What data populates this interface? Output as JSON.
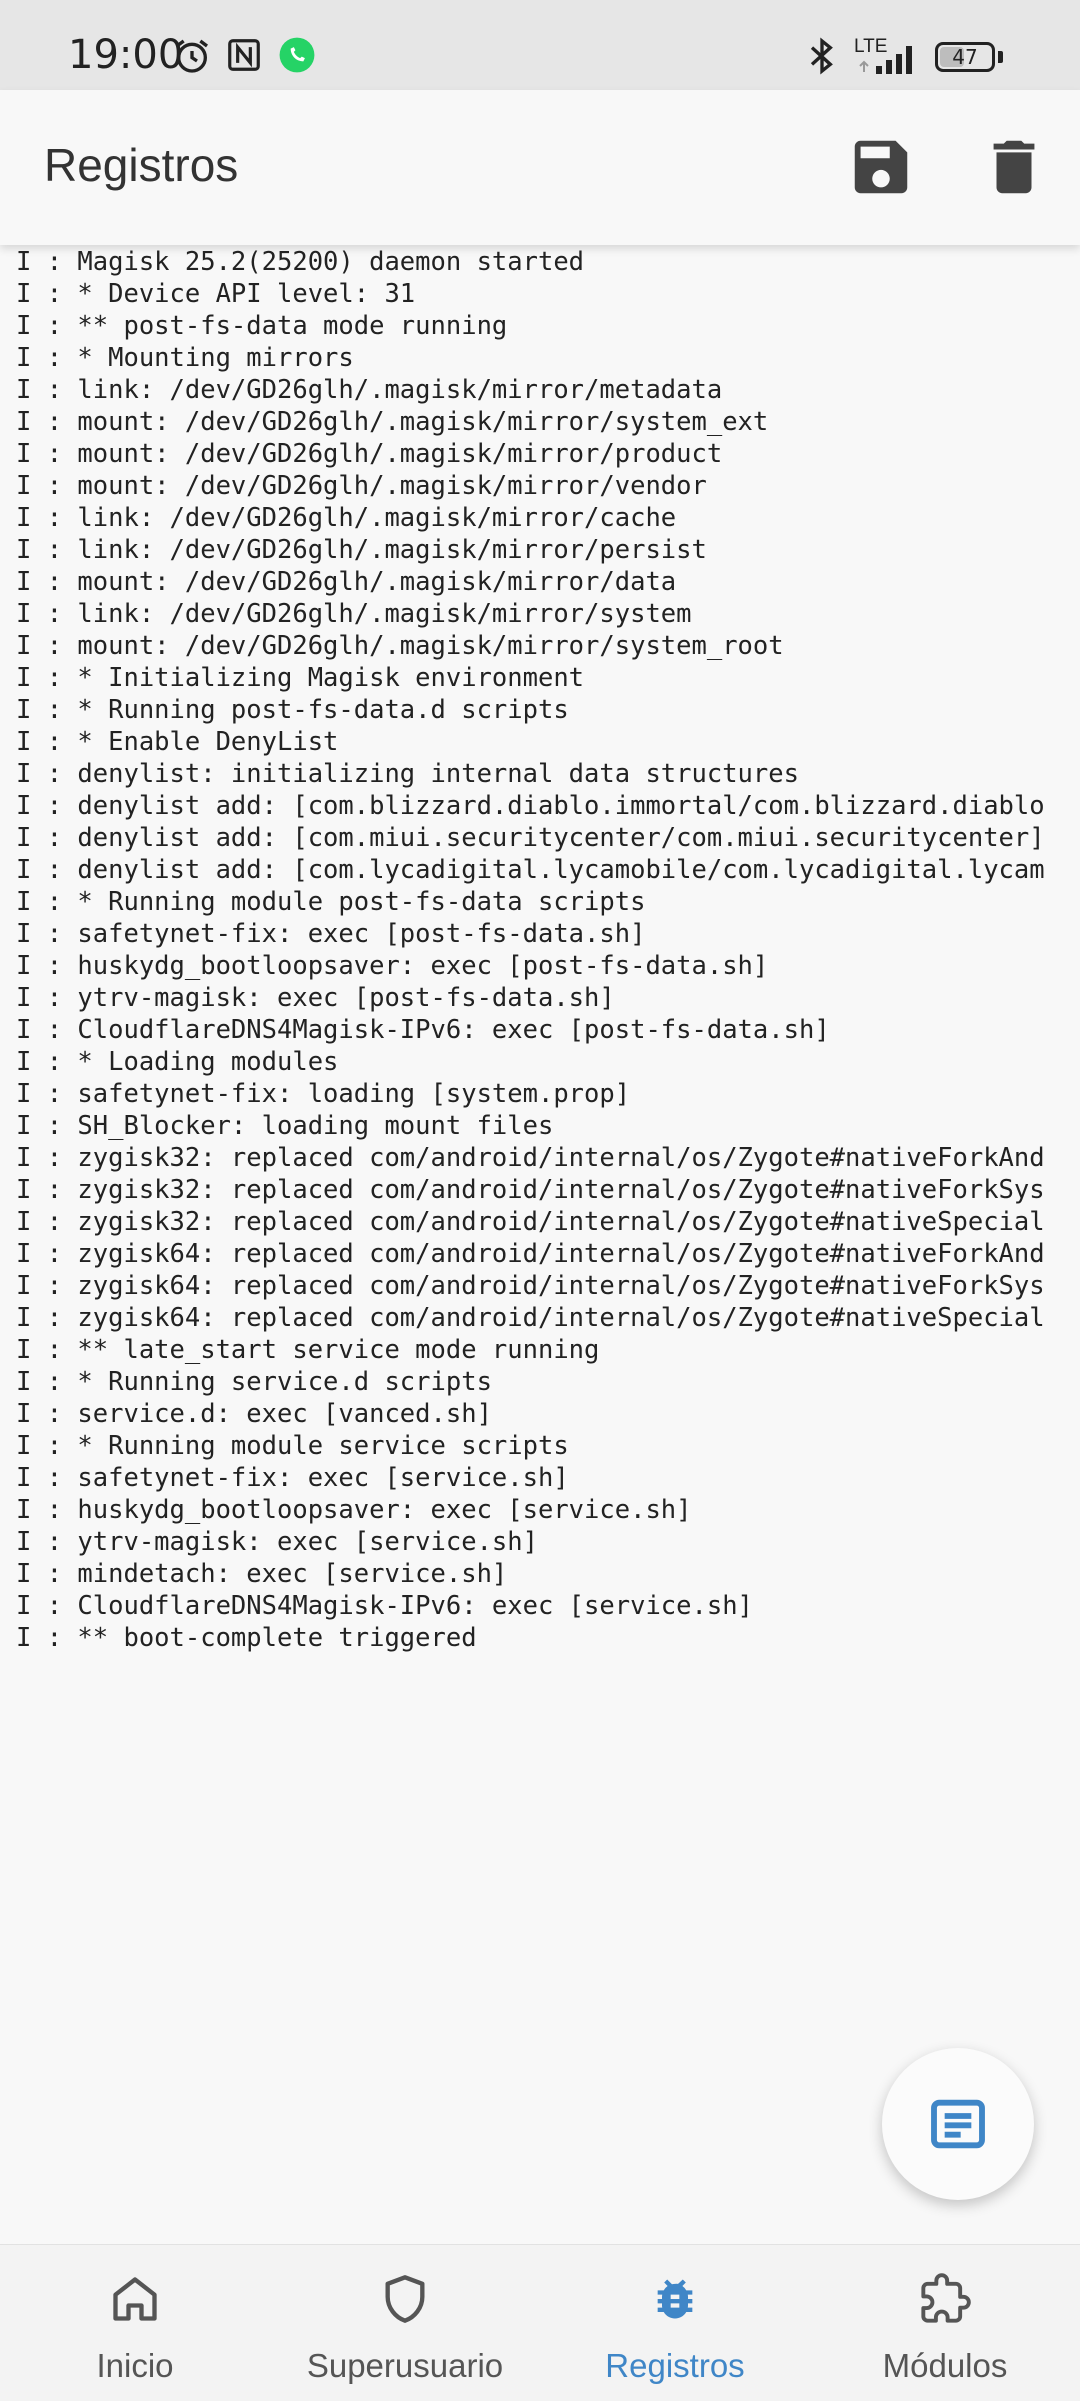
{
  "status_bar": {
    "time": "19:00",
    "network": "LTE",
    "battery": "47"
  },
  "app_bar": {
    "title": "Registros"
  },
  "log": {
    "lines": [
      "I : Magisk 25.2(25200) daemon started",
      "I : * Device API level: 31",
      "I : ** post-fs-data mode running",
      "I : * Mounting mirrors",
      "I : link: /dev/GD26glh/.magisk/mirror/metadata",
      "I : mount: /dev/GD26glh/.magisk/mirror/system_ext",
      "I : mount: /dev/GD26glh/.magisk/mirror/product",
      "I : mount: /dev/GD26glh/.magisk/mirror/vendor",
      "I : link: /dev/GD26glh/.magisk/mirror/cache",
      "I : link: /dev/GD26glh/.magisk/mirror/persist",
      "I : mount: /dev/GD26glh/.magisk/mirror/data",
      "I : link: /dev/GD26glh/.magisk/mirror/system",
      "I : mount: /dev/GD26glh/.magisk/mirror/system_root",
      "I : * Initializing Magisk environment",
      "I : * Running post-fs-data.d scripts",
      "I : * Enable DenyList",
      "I : denylist: initializing internal data structures",
      "I : denylist add: [com.blizzard.diablo.immortal/com.blizzard.diablo",
      "I : denylist add: [com.miui.securitycenter/com.miui.securitycenter]",
      "I : denylist add: [com.lycadigital.lycamobile/com.lycadigital.lycam",
      "I : * Running module post-fs-data scripts",
      "I : safetynet-fix: exec [post-fs-data.sh]",
      "I : huskydg_bootloopsaver: exec [post-fs-data.sh]",
      "I : ytrv-magisk: exec [post-fs-data.sh]",
      "I : CloudflareDNS4Magisk-IPv6: exec [post-fs-data.sh]",
      "I : * Loading modules",
      "I : safetynet-fix: loading [system.prop]",
      "I : SH_Blocker: loading mount files",
      "I : zygisk32: replaced com/android/internal/os/Zygote#nativeForkAnd",
      "I : zygisk32: replaced com/android/internal/os/Zygote#nativeForkSys",
      "I : zygisk32: replaced com/android/internal/os/Zygote#nativeSpecial",
      "I : zygisk64: replaced com/android/internal/os/Zygote#nativeForkAnd",
      "I : zygisk64: replaced com/android/internal/os/Zygote#nativeForkSys",
      "I : zygisk64: replaced com/android/internal/os/Zygote#nativeSpecial",
      "I : ** late_start service mode running",
      "I : * Running service.d scripts",
      "I : service.d: exec [vanced.sh]",
      "I : * Running module service scripts",
      "I : safetynet-fix: exec [service.sh]",
      "I : huskydg_bootloopsaver: exec [service.sh]",
      "I : ytrv-magisk: exec [service.sh]",
      "I : mindetach: exec [service.sh]",
      "I : CloudflareDNS4Magisk-IPv6: exec [service.sh]",
      "I : ** boot-complete triggered"
    ]
  },
  "nav": {
    "items": [
      {
        "label": "Inicio",
        "icon": "home-icon"
      },
      {
        "label": "Superusuario",
        "icon": "shield-icon"
      },
      {
        "label": "Registros",
        "icon": "bug-icon"
      },
      {
        "label": "Módulos",
        "icon": "puzzle-icon"
      }
    ],
    "active_index": 2
  },
  "colors": {
    "accent": "#3f86c7",
    "icon_dark": "#444444",
    "background": "#f8f8f8"
  }
}
